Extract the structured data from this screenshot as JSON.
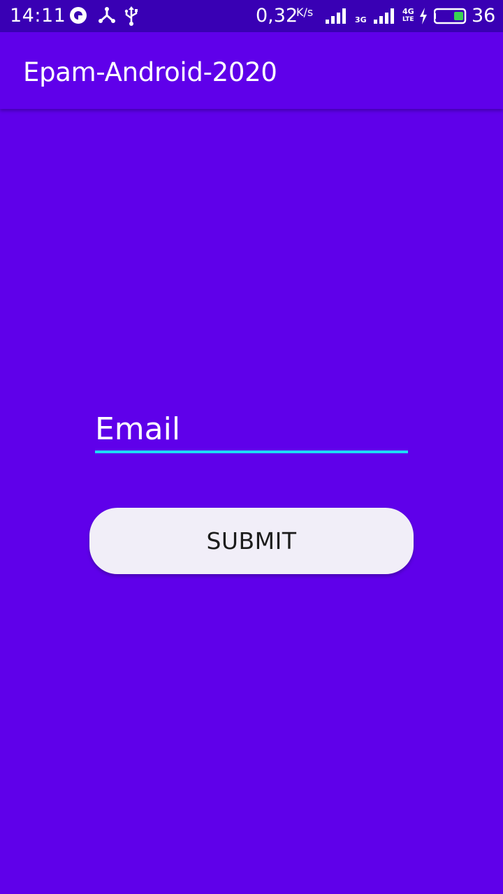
{
  "status_bar": {
    "time": "14:11",
    "network_speed": "0,32",
    "network_speed_unit": "K/s",
    "network_type_1": "3G",
    "network_type_2": "4G",
    "network_type_2_sub": "LTE",
    "battery_level": "36",
    "battery_color": "#39d353",
    "icons": [
      "sync-icon",
      "share-icon",
      "usb-icon",
      "signal-icon",
      "signal-icon",
      "charging-icon",
      "battery-icon"
    ]
  },
  "app_bar": {
    "title": "Epam-Android-2020"
  },
  "form": {
    "email_placeholder": "Email",
    "email_value": "",
    "submit_label": "SUBMIT"
  },
  "colors": {
    "primary": "#5f00ea",
    "status_bar": "#3900b4",
    "accent": "#1ed8f5",
    "button_background": "#f1eef8"
  }
}
